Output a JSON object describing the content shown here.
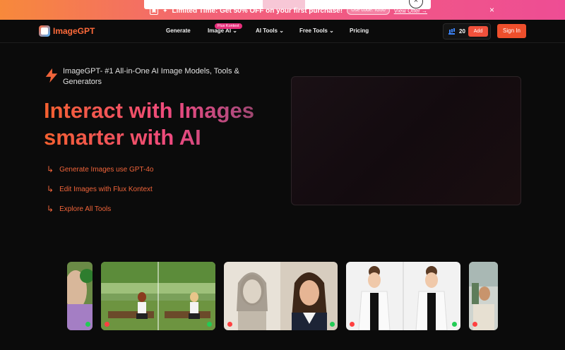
{
  "promo": {
    "title": "Limited Time: Get 50% OFF on your first purchase!",
    "code": "Use code: IG50",
    "view_offer": "View Offer →",
    "close": "×",
    "gift_icon": "gift-icon",
    "colors": {
      "start": "#f7893b",
      "end": "#ee4d94"
    }
  },
  "nav": {
    "brand": "ImageGPT",
    "links": [
      "Generate",
      "Image AI",
      "AI Tools",
      "Free Tools",
      "Pricing"
    ],
    "badge": "Flux Kontext",
    "credits": "20",
    "add": "Add",
    "signin": "Sign In"
  },
  "hero": {
    "tagline": "ImageGPT- #1 All-in-One AI Image Models, Tools & Generators",
    "headline_line1": "Interact with Images",
    "headline_line2": "smarter with AI",
    "features": [
      "Generate Images use GPT-4o",
      "Edit Images with Flux Kontext",
      "Explore All Tools"
    ]
  },
  "colors": {
    "accent": "#f0513c",
    "brand": "#ff6a3a",
    "pink": "#e7307c"
  }
}
